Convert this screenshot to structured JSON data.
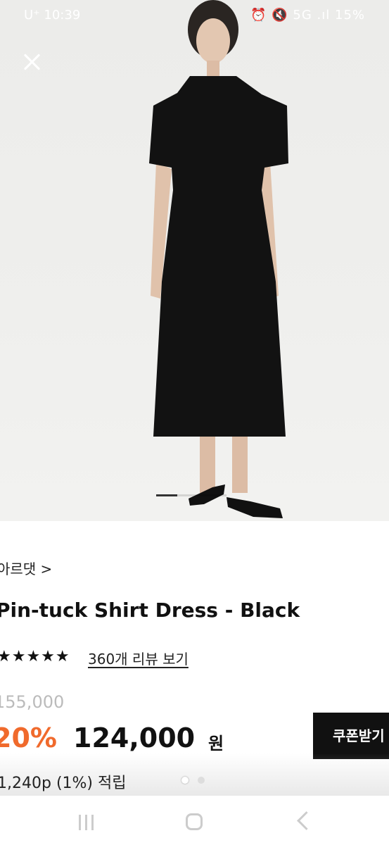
{
  "status_bar": {
    "carrier_time": "U⁺ 10:39",
    "indicators": "⏰ 🔇 5G .ıl 15%"
  },
  "gallery": {
    "close_icon": "close-icon",
    "progress": 0.3
  },
  "product": {
    "brand_link": "아르댓 >",
    "title": "Pin-tuck Shirt Dress - Black",
    "rating_stars": "★★★★★",
    "review_link": "360개 리뷰 보기",
    "original_price": "155,000",
    "discount": "20%",
    "price": "124,000",
    "currency": "원",
    "coupon_button": "쿠폰받기",
    "points": "1,240p (1%) 적립"
  },
  "carousel_dots": {
    "count": 2,
    "active": 0
  },
  "colors": {
    "discount": "#f06a2c",
    "coupon_bg": "#111111"
  }
}
